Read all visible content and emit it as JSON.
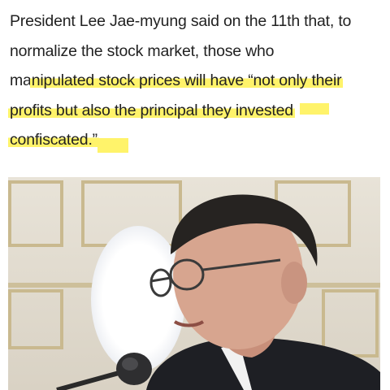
{
  "article": {
    "lines": [
      "President Lee Jae-myung said on the 11th that, to",
      "normalize the stock market, those who",
      "ma",
      "nipulated stock prices will have “not only their",
      "profits but also the principal they invested",
      "confiscated.”"
    ]
  },
  "photo": {
    "subject": "president-speaking-at-microphone",
    "colors": {
      "wall": "#e4ded3",
      "panel_trim": "#c9b98f",
      "jacket": "#1e1f24",
      "skin": "#d7a58f",
      "hair": "#262321",
      "light": "#ffffff"
    }
  }
}
